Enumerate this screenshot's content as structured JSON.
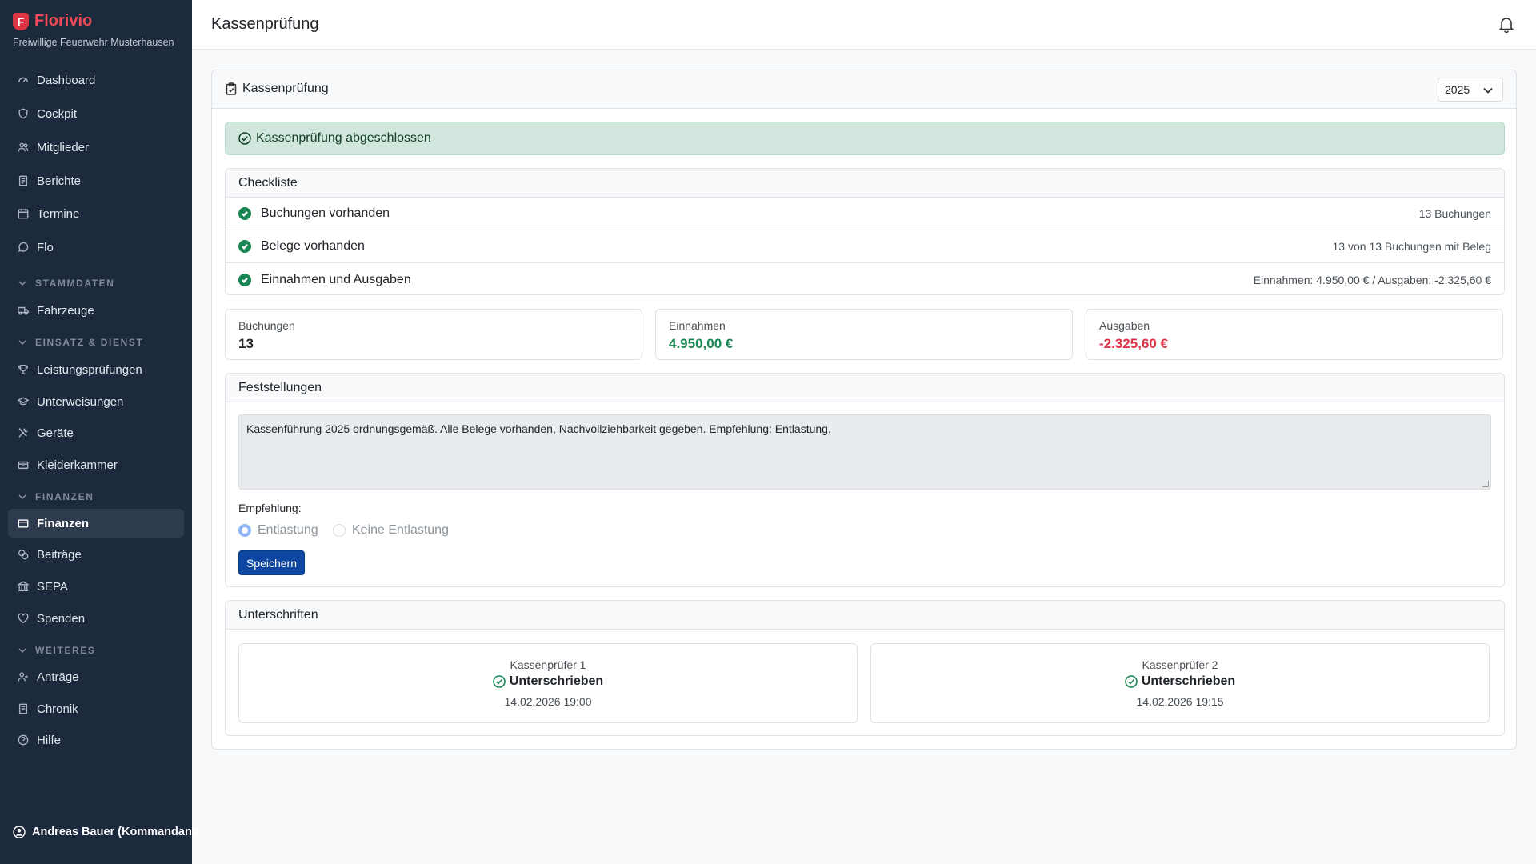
{
  "app": {
    "name": "Florivio",
    "org": "Freiwillige Feuerwehr Musterhausen",
    "logo_letter": "F"
  },
  "sidebar": {
    "items": [
      {
        "label": "Dashboard",
        "icon": "gauge-icon"
      },
      {
        "label": "Cockpit",
        "icon": "shield-icon"
      },
      {
        "label": "Mitglieder",
        "icon": "people-icon"
      },
      {
        "label": "Berichte",
        "icon": "document-icon"
      },
      {
        "label": "Termine",
        "icon": "calendar-icon"
      },
      {
        "label": "Flo",
        "icon": "chat-icon"
      }
    ],
    "sections": [
      {
        "title": "STAMMDATEN",
        "items": [
          {
            "label": "Fahrzeuge",
            "icon": "truck-icon"
          }
        ]
      },
      {
        "title": "EINSATZ & DIENST",
        "items": [
          {
            "label": "Leistungsprüfungen",
            "icon": "trophy-icon"
          },
          {
            "label": "Unterweisungen",
            "icon": "mortarboard-icon"
          },
          {
            "label": "Geräte",
            "icon": "tools-icon"
          },
          {
            "label": "Kleiderkammer",
            "icon": "box-icon"
          }
        ]
      },
      {
        "title": "FINANZEN",
        "items": [
          {
            "label": "Finanzen",
            "icon": "wallet-icon",
            "active": true
          },
          {
            "label": "Beiträge",
            "icon": "coins-icon"
          },
          {
            "label": "SEPA",
            "icon": "bank-icon"
          },
          {
            "label": "Spenden",
            "icon": "heart-icon"
          }
        ]
      },
      {
        "title": "WEITERES",
        "items": [
          {
            "label": "Anträge",
            "icon": "person-plus-icon"
          },
          {
            "label": "Chronik",
            "icon": "journal-icon"
          },
          {
            "label": "Hilfe",
            "icon": "question-icon"
          }
        ]
      }
    ],
    "user": "Andreas Bauer (Kommandant)"
  },
  "header": {
    "title": "Kassenprüfung"
  },
  "card": {
    "title": "Kassenprüfung",
    "year": "2025",
    "alert": "Kassenprüfung abgeschlossen",
    "checklist": {
      "title": "Checkliste",
      "rows": [
        {
          "label": "Buchungen vorhanden",
          "detail": "13 Buchungen"
        },
        {
          "label": "Belege vorhanden",
          "detail": "13 von 13 Buchungen mit Beleg"
        },
        {
          "label": "Einnahmen und Ausgaben",
          "detail": "Einnahmen: 4.950,00 € / Ausgaben: -2.325,60 €"
        }
      ]
    },
    "stats": [
      {
        "label": "Buchungen",
        "value": "13",
        "color": "#212529"
      },
      {
        "label": "Einnahmen",
        "value": "4.950,00 €",
        "color": "#198754"
      },
      {
        "label": "Ausgaben",
        "value": "-2.325,60 €",
        "color": "#dc3545"
      }
    ],
    "findings": {
      "title": "Feststellungen",
      "text": "Kassenführung 2025 ordnungsgemäß. Alle Belege vorhanden, Nachvollziehbarkeit gegeben. Empfehlung: Entlastung.",
      "recommendation_label": "Empfehlung:",
      "options": [
        {
          "label": "Entlastung",
          "selected": true
        },
        {
          "label": "Keine Entlastung",
          "selected": false
        }
      ],
      "save_label": "Speichern"
    },
    "signatures": {
      "title": "Unterschriften",
      "items": [
        {
          "role": "Kassenprüfer 1",
          "status": "Unterschrieben",
          "date": "14.02.2026 19:00"
        },
        {
          "role": "Kassenprüfer 2",
          "status": "Unterschrieben",
          "date": "14.02.2026 19:15"
        }
      ]
    }
  }
}
